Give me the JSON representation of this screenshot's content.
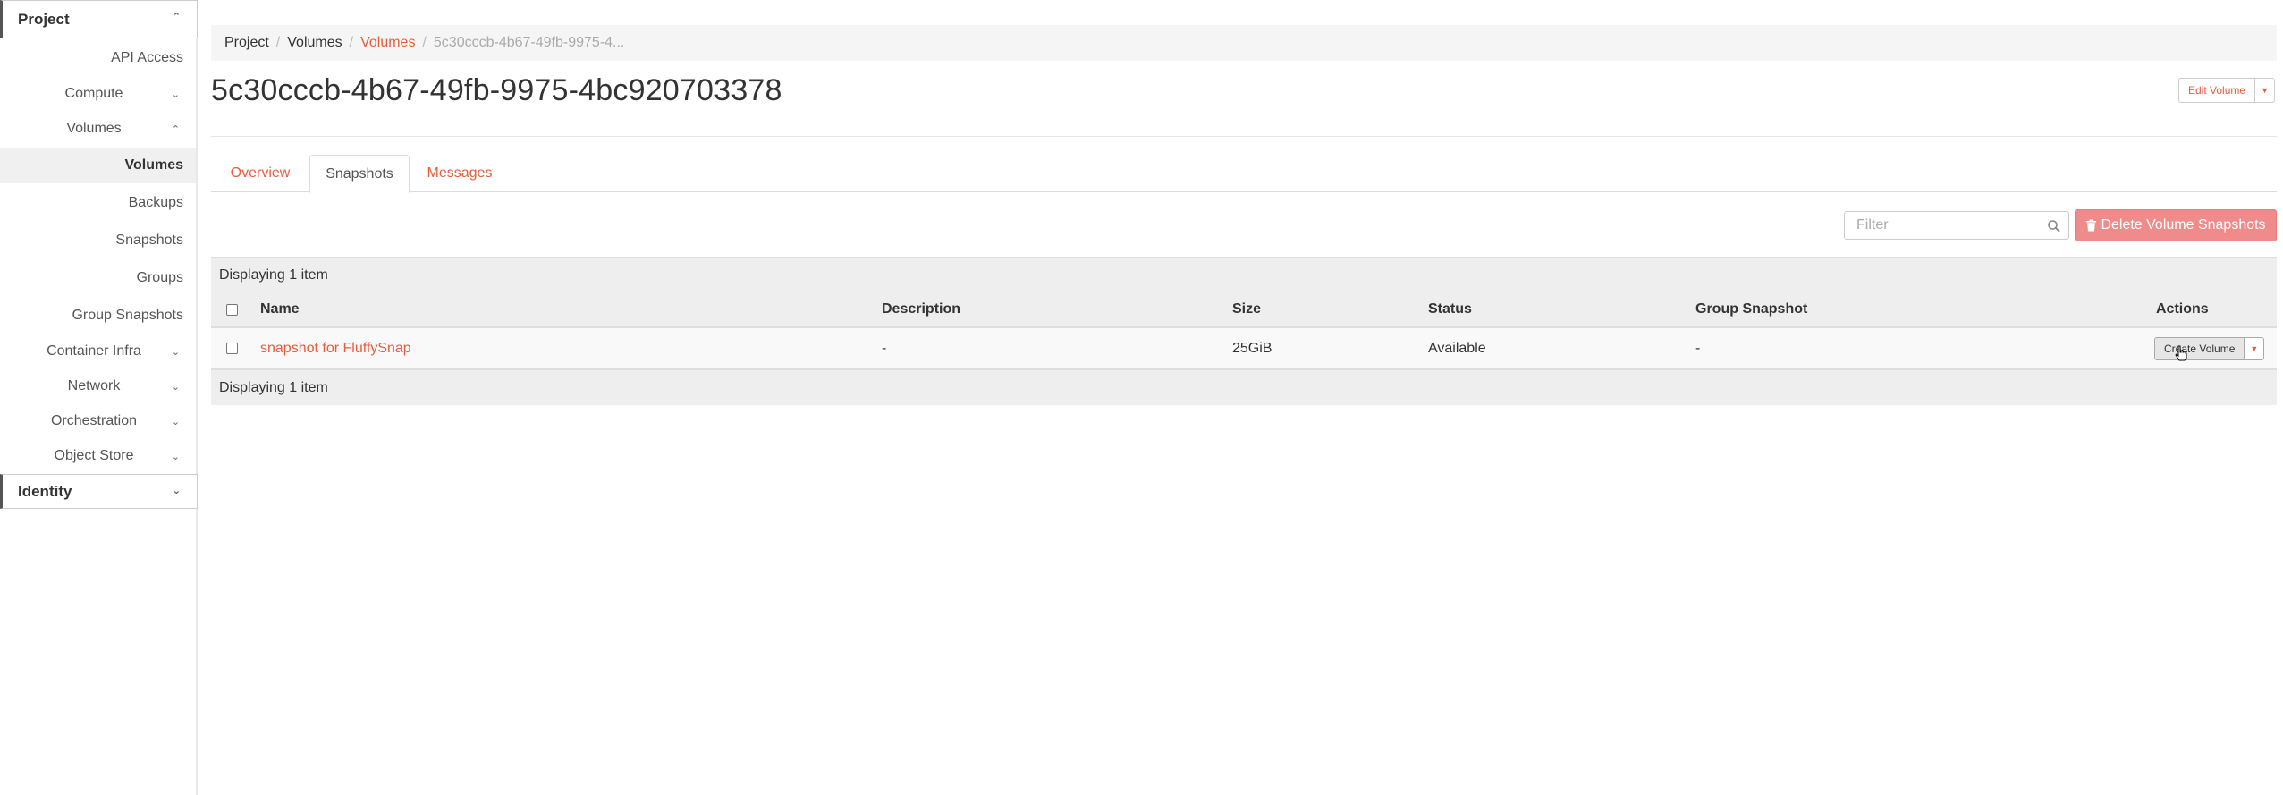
{
  "sidebar": {
    "project_label": "Project",
    "identity_label": "Identity",
    "items": [
      {
        "label": "API Access"
      },
      {
        "label": "Compute"
      },
      {
        "label": "Volumes"
      },
      {
        "label": "Volumes"
      },
      {
        "label": "Backups"
      },
      {
        "label": "Snapshots"
      },
      {
        "label": "Groups"
      },
      {
        "label": "Group Snapshots"
      },
      {
        "label": "Container Infra"
      },
      {
        "label": "Network"
      },
      {
        "label": "Orchestration"
      },
      {
        "label": "Object Store"
      }
    ]
  },
  "breadcrumb": [
    "Project",
    "Volumes",
    "Volumes",
    "5c30cccb-4b67-49fb-9975-4..."
  ],
  "page_title": "5c30cccb-4b67-49fb-9975-4bc920703378",
  "edit_button": "Edit Volume",
  "tabs": [
    "Overview",
    "Snapshots",
    "Messages"
  ],
  "active_tab": "Snapshots",
  "filter": {
    "placeholder": "Filter",
    "value": ""
  },
  "delete_button": "Delete Volume Snapshots",
  "table": {
    "info": "Displaying 1 item",
    "headers": [
      "Name",
      "Description",
      "Size",
      "Status",
      "Group Snapshot",
      "Actions"
    ],
    "rows": [
      {
        "name": "snapshot for FluffySnap",
        "description": "-",
        "size": "25GiB",
        "status": "Available",
        "group_snapshot": "-",
        "action": "Create Volume"
      }
    ],
    "footer": "Displaying 1 item"
  },
  "colors": {
    "accent": "#e85b3c",
    "danger": "#f08b8b"
  }
}
